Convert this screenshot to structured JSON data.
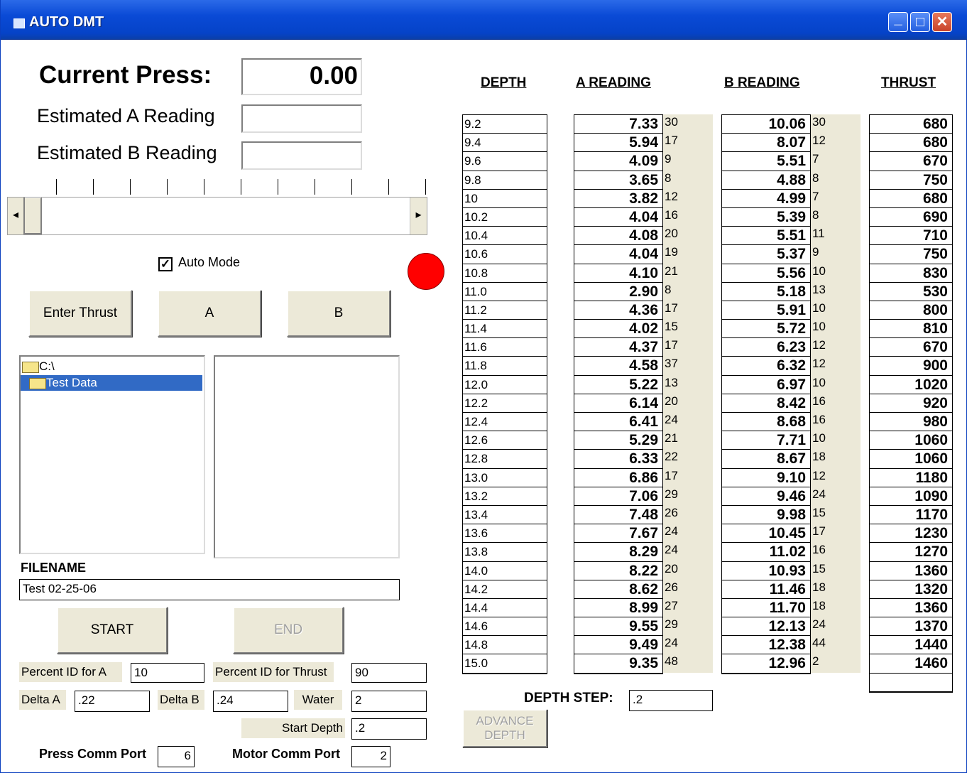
{
  "window": {
    "title": "AUTO DMT",
    "minimize": "_",
    "maximize": "□",
    "close": "✕"
  },
  "press": {
    "current_label": "Current Press:",
    "current_value": "0.00",
    "est_a_label": "Estimated A Reading",
    "est_a_value": "",
    "est_b_label": "Estimated B Reading",
    "est_b_value": ""
  },
  "slider": {
    "left_arrow": "◂",
    "right_arrow": "▸",
    "position_fraction": 0.0
  },
  "auto_mode": {
    "label": "Auto Mode",
    "checked": true,
    "check_glyph": "✓"
  },
  "indicator": {
    "color": "#ff0000"
  },
  "buttons": {
    "enter_thrust": "Enter Thrust",
    "a": "A",
    "b": "B",
    "start": "START",
    "end": "END",
    "advance_depth_1": "ADVANCE",
    "advance_depth_2": "DEPTH"
  },
  "folders": [
    {
      "name": "C:\\",
      "selected": false
    },
    {
      "name": "Test Data",
      "selected": true
    }
  ],
  "filename": {
    "label": "FILENAME",
    "value": "Test 02-25-06"
  },
  "settings": {
    "percent_a_label": "Percent ID for A",
    "percent_a_value": "10",
    "percent_thrust_label": "Percent ID for Thrust",
    "percent_thrust_value": "90",
    "delta_a_label": "Delta A",
    "delta_a_value": ".22",
    "delta_b_label": "Delta B",
    "delta_b_value": ".24",
    "water_label": "Water",
    "water_value": "2",
    "start_depth_label": "Start Depth",
    "start_depth_value": ".2",
    "press_port_label": "Press Comm Port",
    "press_port_value": "6",
    "motor_port_label": "Motor Comm Port",
    "motor_port_value": "2"
  },
  "table": {
    "headers": {
      "depth": "DEPTH",
      "a": "A READING",
      "b": "B READING",
      "thrust": "THRUST"
    },
    "depth_step_label": "DEPTH STEP:",
    "depth_step_value": ".2",
    "rows": [
      {
        "depth": "9.2",
        "a": "7.33",
        "a_n": "30",
        "b": "10.06",
        "b_n": "30",
        "thrust": "680"
      },
      {
        "depth": "9.4",
        "a": "5.94",
        "a_n": "17",
        "b": "8.07",
        "b_n": "12",
        "thrust": "680"
      },
      {
        "depth": "9.6",
        "a": "4.09",
        "a_n": "9",
        "b": "5.51",
        "b_n": "7",
        "thrust": "670"
      },
      {
        "depth": "9.8",
        "a": "3.65",
        "a_n": "8",
        "b": "4.88",
        "b_n": "8",
        "thrust": "750"
      },
      {
        "depth": "10",
        "a": "3.82",
        "a_n": "12",
        "b": "4.99",
        "b_n": "7",
        "thrust": "680"
      },
      {
        "depth": "10.2",
        "a": "4.04",
        "a_n": "16",
        "b": "5.39",
        "b_n": "8",
        "thrust": "690"
      },
      {
        "depth": "10.4",
        "a": "4.08",
        "a_n": "20",
        "b": "5.51",
        "b_n": "11",
        "thrust": "710"
      },
      {
        "depth": "10.6",
        "a": "4.04",
        "a_n": "19",
        "b": "5.37",
        "b_n": "9",
        "thrust": "750"
      },
      {
        "depth": "10.8",
        "a": "4.10",
        "a_n": "21",
        "b": "5.56",
        "b_n": "10",
        "thrust": "830"
      },
      {
        "depth": "11.0",
        "a": "2.90",
        "a_n": "8",
        "b": "5.18",
        "b_n": "13",
        "thrust": "530"
      },
      {
        "depth": "11.2",
        "a": "4.36",
        "a_n": "17",
        "b": "5.91",
        "b_n": "10",
        "thrust": "800"
      },
      {
        "depth": "11.4",
        "a": "4.02",
        "a_n": "15",
        "b": "5.72",
        "b_n": "10",
        "thrust": "810"
      },
      {
        "depth": "11.6",
        "a": "4.37",
        "a_n": "17",
        "b": "6.23",
        "b_n": "12",
        "thrust": "670"
      },
      {
        "depth": "11.8",
        "a": "4.58",
        "a_n": "37",
        "b": "6.32",
        "b_n": "12",
        "thrust": "900"
      },
      {
        "depth": "12.0",
        "a": "5.22",
        "a_n": "13",
        "b": "6.97",
        "b_n": "10",
        "thrust": "1020"
      },
      {
        "depth": "12.2",
        "a": "6.14",
        "a_n": "20",
        "b": "8.42",
        "b_n": "16",
        "thrust": "920"
      },
      {
        "depth": "12.4",
        "a": "6.41",
        "a_n": "24",
        "b": "8.68",
        "b_n": "16",
        "thrust": "980"
      },
      {
        "depth": "12.6",
        "a": "5.29",
        "a_n": "21",
        "b": "7.71",
        "b_n": "10",
        "thrust": "1060"
      },
      {
        "depth": "12.8",
        "a": "6.33",
        "a_n": "22",
        "b": "8.67",
        "b_n": "18",
        "thrust": "1060"
      },
      {
        "depth": "13.0",
        "a": "6.86",
        "a_n": "17",
        "b": "9.10",
        "b_n": "12",
        "thrust": "1180"
      },
      {
        "depth": "13.2",
        "a": "7.06",
        "a_n": "29",
        "b": "9.46",
        "b_n": "24",
        "thrust": "1090"
      },
      {
        "depth": "13.4",
        "a": "7.48",
        "a_n": "26",
        "b": "9.98",
        "b_n": "15",
        "thrust": "1170"
      },
      {
        "depth": "13.6",
        "a": "7.67",
        "a_n": "24",
        "b": "10.45",
        "b_n": "17",
        "thrust": "1230"
      },
      {
        "depth": "13.8",
        "a": "8.29",
        "a_n": "24",
        "b": "11.02",
        "b_n": "16",
        "thrust": "1270"
      },
      {
        "depth": "14.0",
        "a": "8.22",
        "a_n": "20",
        "b": "10.93",
        "b_n": "15",
        "thrust": "1360"
      },
      {
        "depth": "14.2",
        "a": "8.62",
        "a_n": "26",
        "b": "11.46",
        "b_n": "18",
        "thrust": "1320"
      },
      {
        "depth": "14.4",
        "a": "8.99",
        "a_n": "27",
        "b": "11.70",
        "b_n": "18",
        "thrust": "1360"
      },
      {
        "depth": "14.6",
        "a": "9.55",
        "a_n": "29",
        "b": "12.13",
        "b_n": "24",
        "thrust": "1370"
      },
      {
        "depth": "14.8",
        "a": "9.49",
        "a_n": "24",
        "b": "12.38",
        "b_n": "44",
        "thrust": "1440"
      },
      {
        "depth": "15.0",
        "a": "9.35",
        "a_n": "48",
        "b": "12.96",
        "b_n": "2",
        "thrust": "1460"
      },
      {
        "depth": "",
        "a": "",
        "a_n": "",
        "b": "",
        "b_n": "",
        "thrust": ""
      }
    ]
  }
}
